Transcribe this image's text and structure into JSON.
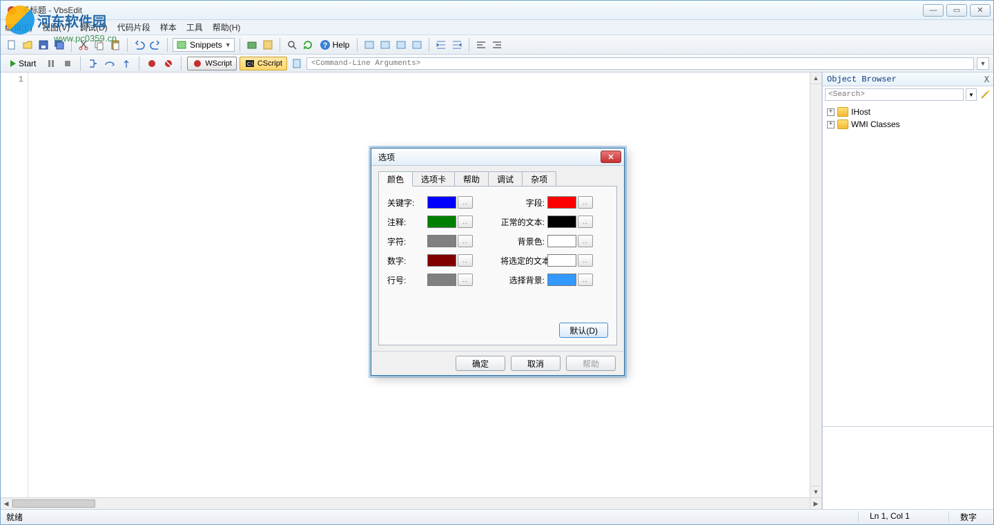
{
  "watermark": {
    "text": "河东软件园",
    "url": "www.pc0359.cn"
  },
  "window": {
    "title": "无标题 - VbsEdit",
    "menu": [
      "编辑(E)",
      "视图(V)",
      "调试(D)",
      "代码片段",
      "样本",
      "工具",
      "帮助(H)"
    ]
  },
  "toolbar": {
    "snippets_label": "Snippets",
    "help_label": "Help"
  },
  "toolbar2": {
    "start": "Start",
    "wscript": "WScript",
    "cscript": "CScript",
    "cmdargs": "<Command-Line Arguments>"
  },
  "editor": {
    "line1": "1"
  },
  "objbrowser": {
    "title": "Object Browser",
    "close": "X",
    "search_placeholder": "<Search>",
    "items": [
      "IHost",
      "WMI Classes"
    ]
  },
  "status": {
    "ready": "就绪",
    "pos": "Ln 1, Col 1",
    "mode": "数字"
  },
  "dialog": {
    "title": "选项",
    "tabs": [
      "颜色",
      "选项卡",
      "帮助",
      "调试",
      "杂项"
    ],
    "rows": [
      {
        "l_label": "关键字:",
        "l_color": "#0000ff",
        "r_label": "字段:",
        "r_color": "#ff0000"
      },
      {
        "l_label": "注释:",
        "l_color": "#008000",
        "r_label": "正常的文本:",
        "r_color": "#000000"
      },
      {
        "l_label": "字符:",
        "l_color": "#808080",
        "r_label": "背景色:",
        "r_color": "#ffffff"
      },
      {
        "l_label": "数字:",
        "l_color": "#800000",
        "r_label": "将选定的文本:",
        "r_color": "#ffffff"
      },
      {
        "l_label": "行号:",
        "l_color": "#808080",
        "r_label": "选择背景:",
        "r_color": "#3399ff"
      }
    ],
    "picker": "..",
    "default": "默认(D)",
    "ok": "确定",
    "cancel": "取消",
    "help": "帮助"
  }
}
